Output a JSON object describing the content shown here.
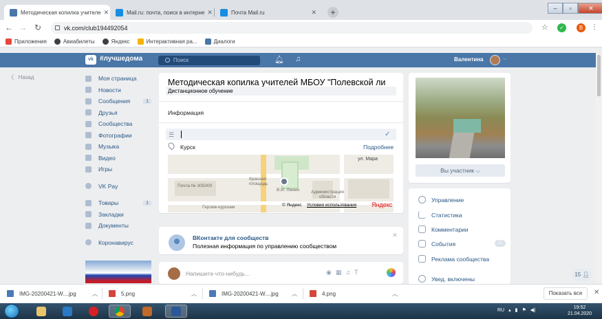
{
  "browser": {
    "tabs": [
      {
        "title": "Методическая копилка учителе",
        "active": true,
        "favicon_color": "#4a76a8"
      },
      {
        "title": "Mail.ru: почта, поиск в интерне",
        "active": false,
        "favicon_color": "#168de2"
      },
      {
        "title": "Почта Mail.ru",
        "active": false,
        "favicon_color": "#168de2"
      }
    ],
    "url": "vk.com/club194492054",
    "profile_letter": "B",
    "bookmarks": [
      {
        "label": "Приложения",
        "color": "#e8453c"
      },
      {
        "label": "Авиабилеты",
        "color": "#3c4043"
      },
      {
        "label": "Яндекс",
        "color": "#3c4043"
      },
      {
        "label": "Интерактивная ра...",
        "color": "#f4b400"
      },
      {
        "label": "Диалоги",
        "color": "#4a76a8"
      }
    ]
  },
  "vk": {
    "logo": "vk",
    "hashtag": "#лучшедома",
    "search_placeholder": "Поиск",
    "username": "Валентина",
    "back": "Назад",
    "nav": [
      {
        "label": "Моя страница",
        "count": ""
      },
      {
        "label": "Новости",
        "count": ""
      },
      {
        "label": "Сообщения",
        "count": "1"
      },
      {
        "label": "Друзья",
        "count": ""
      },
      {
        "label": "Сообщества",
        "count": ""
      },
      {
        "label": "Фотографии",
        "count": ""
      },
      {
        "label": "Музыка",
        "count": ""
      },
      {
        "label": "Видео",
        "count": ""
      },
      {
        "label": "Игры",
        "count": ""
      }
    ],
    "nav2": [
      {
        "label": "VK Pay",
        "count": ""
      }
    ],
    "nav3": [
      {
        "label": "Товары",
        "count": "1"
      },
      {
        "label": "Закладки",
        "count": ""
      },
      {
        "label": "Документы",
        "count": ""
      }
    ],
    "nav4": [
      {
        "label": "Коронавирус",
        "count": ""
      }
    ]
  },
  "group": {
    "title": "Методическая копилка учителей МБОУ \"Полевской ли",
    "status": "Дистанционное обучение",
    "info_label": "Информация",
    "city": "Курск",
    "more_link": "Подробнее"
  },
  "map": {
    "street": "ул. Мара",
    "post": "Почта № 305000",
    "square": "Красная площадь",
    "monument": "В.И. Ленин",
    "admin": "Администрация области",
    "heroes": "Героев-курскам",
    "copyright": "© Яндекс",
    "terms": "Условия использования",
    "brand": "Яндекс"
  },
  "notice": {
    "title": "ВКонтакте для сообществ",
    "text": "Полезная информация по управлению сообществом"
  },
  "post": {
    "placeholder": "Напишите что-нибудь..."
  },
  "right": {
    "member_button": "Вы участник ⌵",
    "menu": [
      {
        "label": "Управление",
        "count": ""
      },
      {
        "label": "Статистика",
        "count": ""
      },
      {
        "label": "Комментарии",
        "count": ""
      },
      {
        "label": "События",
        "count": "21"
      },
      {
        "label": "Реклама сообщества",
        "count": ""
      },
      {
        "label": "Увед. включены",
        "count": ""
      }
    ],
    "chat_count": "15"
  },
  "downloads": [
    {
      "name": "IMG-20200421-W....jpg",
      "color": "#4a7bb7"
    },
    {
      "name": "5.png",
      "color": "#d4453a"
    },
    {
      "name": "IMG-20200421-W....jpg",
      "color": "#4a7bb7"
    },
    {
      "name": "4.png",
      "color": "#d4453a"
    }
  ],
  "downloads_show_all": "Показать все",
  "taskbar": {
    "lang": "RU",
    "time": "19:52",
    "date": "21.04.2020"
  }
}
